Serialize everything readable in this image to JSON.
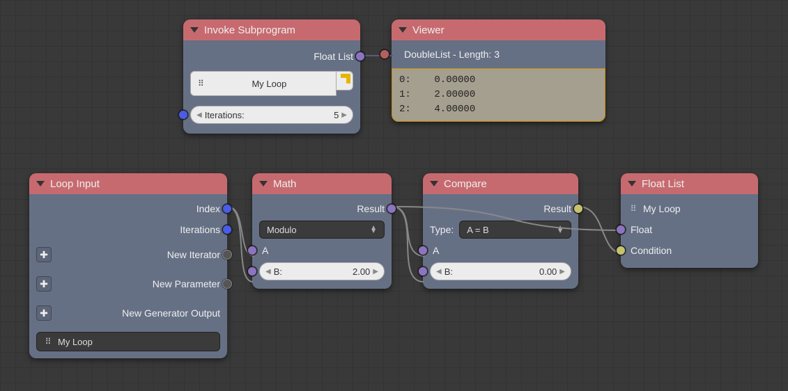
{
  "invoke": {
    "title": "Invoke Subprogram",
    "out_label": "Float List",
    "loop_name": "My Loop",
    "iterations_label": "Iterations:",
    "iterations_value": "5"
  },
  "viewer": {
    "title": "Viewer",
    "type_label": "DoubleList - Length: 3",
    "output_text": "0:    0.00000\n1:    2.00000\n2:    4.00000"
  },
  "loop_input": {
    "title": "Loop Input",
    "out_index": "Index",
    "out_iterations": "Iterations",
    "out_new_iterator": "New Iterator",
    "out_new_parameter": "New Parameter",
    "out_new_gen": "New Generator Output",
    "name": "My Loop"
  },
  "math": {
    "title": "Math",
    "out_result": "Result",
    "operation": "Modulo",
    "in_a": "A",
    "b_label": "B:",
    "b_value": "2.00"
  },
  "compare": {
    "title": "Compare",
    "out_result": "Result",
    "type_label": "Type:",
    "type_value": "A = B",
    "in_a": "A",
    "b_label": "B:",
    "b_value": "0.00"
  },
  "float_list": {
    "title": "Float List",
    "loop_ref": "My Loop",
    "in_float": "Float",
    "in_condition": "Condition"
  }
}
